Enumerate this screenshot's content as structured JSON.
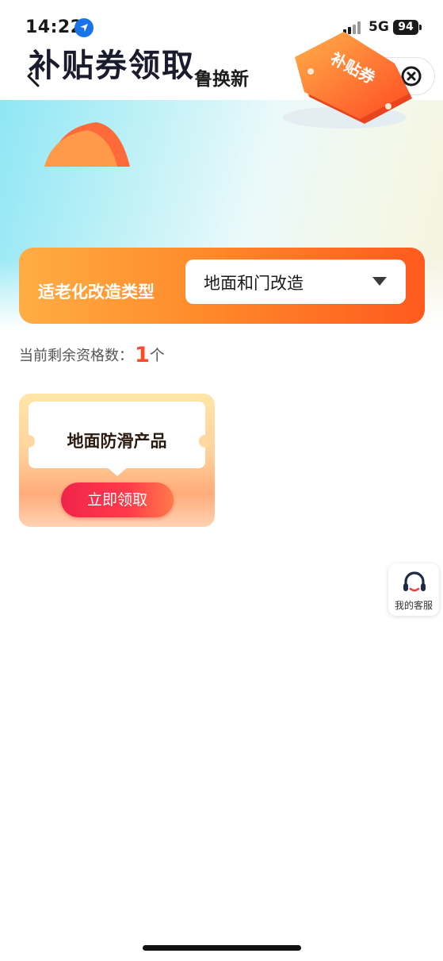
{
  "status_bar": {
    "time": "14:22",
    "network": "5G",
    "battery": "94"
  },
  "nav": {
    "title": "鲁换新",
    "back_icon": "chevron-left-icon",
    "more_icon": "ellipsis-icon",
    "close_icon": "close-circle-icon"
  },
  "banner": {
    "title": "补贴券领取",
    "ticket_text": "补贴券"
  },
  "type_selector": {
    "label": "适老化改造类型",
    "selected": "地面和门改造"
  },
  "remaining": {
    "label": "当前剩余资格数：",
    "count": "1",
    "unit": "个"
  },
  "coupons": [
    {
      "name": "地面防滑产品",
      "action": "立即领取"
    }
  ],
  "service": {
    "label": "我的客服",
    "icon": "headset-icon"
  },
  "colors": {
    "accent": "#ff5a1e",
    "button": "#f0244a",
    "count": "#ff4a2a"
  }
}
